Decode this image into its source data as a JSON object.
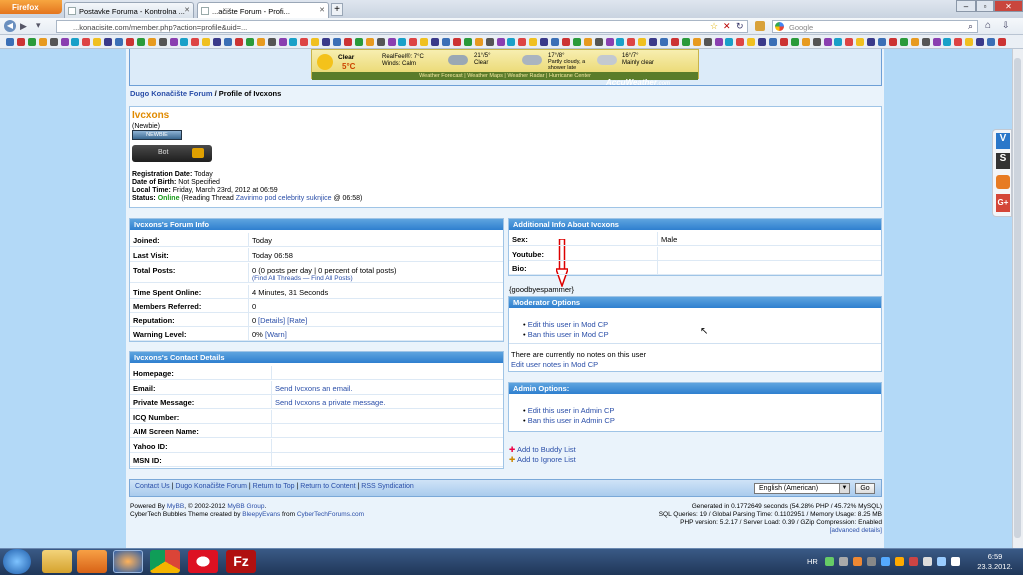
{
  "browser": {
    "menu_button": "Firefox",
    "tabs": [
      {
        "label": "Postavke Foruma - Kontrolna ..."
      },
      {
        "label": "...ačište Forum - Profi..."
      }
    ],
    "new_tab": "+",
    "url": "...konacisite.com/member.php?action=profile&uid=...",
    "search_placeholder": "Google",
    "window_buttons": [
      "–",
      "▫",
      "✕"
    ]
  },
  "weather": {
    "current": {
      "condition": "Clear",
      "temp": "5°C",
      "realfeel": "RealFeel®: 7°C",
      "winds": "Winds: Calm"
    },
    "forecasts": [
      {
        "temp": "21°/5°",
        "desc": "Clear"
      },
      {
        "temp": "17°/8°",
        "desc": "Partly cloudy, a shower late"
      },
      {
        "temp": "16°/7°",
        "desc": "Mainly clear"
      }
    ],
    "links": "Weather Forecast | Weather Maps | Weather Radar | Hurricane Center",
    "brand": "AccuWeather",
    "brand_suffix": ".com"
  },
  "breadcrumb": {
    "forum": "Dugo Konačište Forum",
    "sep": "/",
    "current": "Profile of Ivcxons"
  },
  "profile": {
    "username": "Ivcxons",
    "usertitle": "(Newbie)",
    "badge": "NEWBIE",
    "bot_label": "Bot",
    "registration_label": "Registration Date:",
    "registration_value": "Today",
    "dob_label": "Date of Birth:",
    "dob_value": "Not Specified",
    "localtime_label": "Local Time:",
    "localtime_value": "Friday, March 23rd, 2012 at 06:59",
    "status_label": "Status:",
    "status_online": "Online",
    "status_reading": "(Reading Thread",
    "status_thread": "Zavirimo pod celebrity suknjice",
    "status_time": "@ 06:58)"
  },
  "forum_info": {
    "title": "Ivcxons's Forum Info",
    "rows": [
      {
        "label": "Joined:",
        "value": "Today"
      },
      {
        "label": "Last Visit:",
        "value": "Today 06:58"
      },
      {
        "label": "Total Posts:",
        "value": "0 (0 posts per day | 0 percent of total posts)",
        "sub": "(Find All Threads — Find All Posts)"
      },
      {
        "label": "Time Spent Online:",
        "value": "4 Minutes, 31 Seconds"
      },
      {
        "label": "Members Referred:",
        "value": "0"
      },
      {
        "label": "Reputation:",
        "value": "0",
        "links": "[Details] [Rate]"
      },
      {
        "label": "Warning Level:",
        "value": "0%",
        "links": "[Warn]"
      }
    ]
  },
  "contact": {
    "title": "Ivcxons's Contact Details",
    "rows": [
      {
        "label": "Homepage:",
        "value": ""
      },
      {
        "label": "Email:",
        "value": "Send Ivcxons an email."
      },
      {
        "label": "Private Message:",
        "value": "Send Ivcxons a private message."
      },
      {
        "label": "ICQ Number:",
        "value": ""
      },
      {
        "label": "AIM Screen Name:",
        "value": ""
      },
      {
        "label": "Yahoo ID:",
        "value": ""
      },
      {
        "label": "MSN ID:",
        "value": ""
      }
    ]
  },
  "additional": {
    "title": "Additional Info About Ivcxons",
    "rows": [
      {
        "label": "Sex:",
        "value": "Male"
      },
      {
        "label": "Youtube:",
        "value": ""
      },
      {
        "label": "Bio:",
        "value": ""
      }
    ],
    "signature": "{goodbyespammer}"
  },
  "modopts": {
    "title": "Moderator Options",
    "links": [
      "Edit this user in Mod CP",
      "Ban this user in Mod CP"
    ],
    "notes": "There are currently no notes on this user",
    "edit_notes": "Edit user notes in Mod CP"
  },
  "adminopts": {
    "title": "Admin Options:",
    "links": [
      "Edit this user in Admin CP",
      "Ban this user in Admin CP"
    ]
  },
  "buddy": {
    "add_buddy": "Add to Buddy List",
    "add_ignore": "Add to Ignore List"
  },
  "footer": {
    "links": [
      "Contact Us",
      "Dugo Konačište Forum",
      "Return to Top",
      "Return to Content",
      "RSS Syndication"
    ],
    "language": "English (American)",
    "go": "Go",
    "powered1": "Powered By",
    "mybb": "MyBB",
    "powered2": ", © 2002-2012",
    "mybbgroup": "MyBB Group",
    "theme1": "CyberTech Bubbles Theme created by",
    "bleepy": "BleepyEvans",
    "theme2": "from",
    "ctforums": "CyberTechForums.com",
    "stats1": "Generated in 0.1772649 seconds (54.28% PHP / 45.72% MySQL)",
    "stats2": "SQL Queries: 19 / Global Parsing Time: 0.1102951 / Memory Usage: 8.25 MB",
    "stats3": "PHP version: 5.2.17 / Server Load: 0.39 / GZip Compression: Enabled",
    "advanced": "[advanced details]"
  },
  "taskbar": {
    "lang": "HR",
    "time": "6:59",
    "date": "23.3.2012."
  },
  "colors": {
    "page_bg": "#b3d9f7",
    "header": "#3585d1",
    "link": "#2a4ea8",
    "online": "#1a9a1a",
    "username": "#e08a00"
  }
}
